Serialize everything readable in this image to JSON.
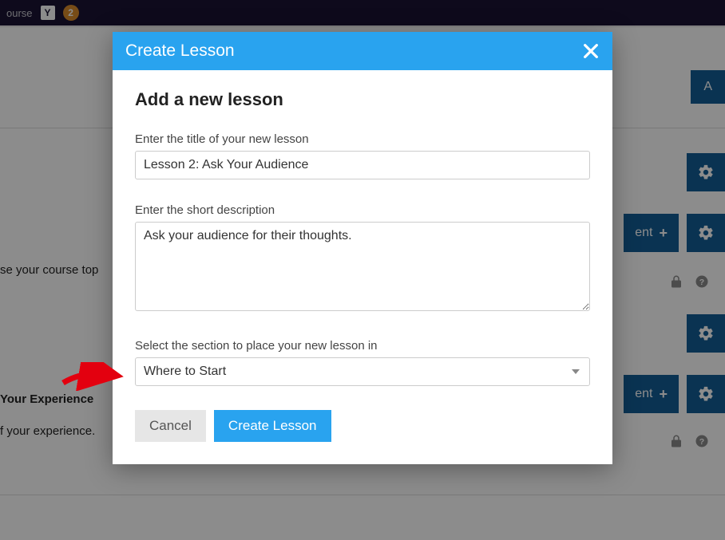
{
  "topbar": {
    "course_text": "ourse",
    "yoast_letter": "Y",
    "notif_count": "2"
  },
  "background": {
    "add_button_letter": "A",
    "course_topic_text": "se your course top",
    "experience_heading": "Your Experience",
    "experience_sub": "f your experience.",
    "content_btn_text": "ent",
    "plus": "+"
  },
  "modal": {
    "header_title": "Create Lesson",
    "subtitle": "Add a new lesson",
    "title_label": "Enter the title of your new lesson",
    "title_value": "Lesson 2: Ask Your Audience",
    "desc_label": "Enter the short description",
    "desc_value": "Ask your audience for their thoughts.",
    "section_label": "Select the section to place your new lesson in",
    "section_selected": "Where to Start",
    "cancel_label": "Cancel",
    "create_label": "Create Lesson"
  }
}
